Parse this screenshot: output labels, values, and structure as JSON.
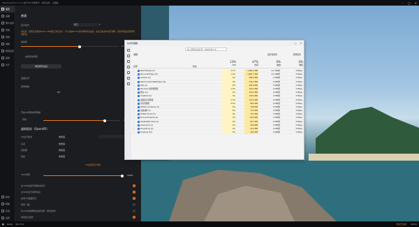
{
  "window": {
    "title": "MaxAssistant 1.2.0 [运行中] 智能助手 - 游戏设置 - 主面板"
  },
  "sidebar": {
    "items": [
      {
        "label": "首页",
        "icon": "home-icon"
      },
      {
        "label": "画面",
        "icon": "display-icon"
      },
      {
        "label": "账户设置",
        "icon": "account-icon"
      },
      {
        "label": "音效",
        "icon": "audio-icon"
      },
      {
        "label": "控制",
        "icon": "controller-icon"
      },
      {
        "label": "辅助",
        "icon": "assist-icon"
      },
      {
        "label": "按键设置",
        "icon": "keyboard-icon"
      },
      {
        "label": "其他",
        "icon": "misc-icon"
      },
      {
        "label": "关于",
        "icon": "info-icon"
      }
    ],
    "bottom": [
      {
        "label": "输出",
        "icon": "output-icon"
      },
      {
        "label": "帮助",
        "icon": "help-icon"
      },
      {
        "label": "反馈",
        "icon": "feedback-icon"
      },
      {
        "label": "设置",
        "icon": "settings-icon"
      }
    ]
  },
  "panel": {
    "title": "普通",
    "mode_label": "显示模式",
    "mode_value": "窗口",
    "warning": "请注意：如果无法看到Radio VR的窗口进行显示，可以使用Radio进行模拟测试设置，在窗口模式中进行调整，游戏可能会出现闪烁的情况。",
    "zoom_label": "缩放值",
    "zoom_value": "1.00",
    "zoom_frac": 0.6,
    "auto_label": "启用自动调整",
    "reset_btn": "重置所有设置",
    "res_label": "画面比例",
    "fps_label": "帧率限制",
    "fps_value": "80",
    "limit_label": "开启VR调整帧率限制",
    "fov_label": "视场",
    "fov_value": "144",
    "fov_frac": 0.8,
    "openxr_title": "虚拟现实（OpenXR）",
    "vr_mode_label": "VR运行模式",
    "vr_mode_value": "未激活",
    "vr_rows": [
      {
        "label": "头显",
        "value": "未激活"
      },
      {
        "label": "控制器",
        "value": "未激活"
      },
      {
        "label": "追踪",
        "value": "未激活"
      }
    ],
    "vr_link": "VR设置显示向导",
    "vr_scale_label": "VR分辨率",
    "vr_scale_value": "100%",
    "vr_scale_frac": 0.98,
    "opts": [
      {
        "label": "在VR中启用手柄震动反馈",
        "on": true
      },
      {
        "label": "在VR中显示帧率信息",
        "on": true
      },
      {
        "label": "启用VR画面稳定",
        "on": true
      },
      {
        "label": "帧率（锁）",
        "on": false
      },
      {
        "label": "在VR中启用眼动追踪功能（测试版本）",
        "on": false
      },
      {
        "label": "游戏窗口模式",
        "on": true
      }
    ]
  },
  "taskmgr": {
    "title": "任务管理器",
    "search_placeholder": "输入要搜索的名称、发布者或 PID",
    "tab": "进程",
    "run_btn": "运行新任务",
    "more_btn": "结束任务",
    "columns": [
      {
        "pct": "13%",
        "name": "CPU"
      },
      {
        "pct": "47%",
        "name": "内存"
      },
      {
        "pct": "0%",
        "name": "磁盘"
      },
      {
        "pct": "0%",
        "name": "网络"
      }
    ],
    "col_name": "名称",
    "col_status": "状态",
    "rows": [
      [
        "BearVR(Lite) (5)",
        "2.7%",
        "1,002.1 MB",
        "0.1 MB/秒",
        "0 Mbps"
      ],
      [
        "Microsoft Edge (27)",
        "1.4%",
        "1,697.7 MB",
        "0.1 MB/秒",
        "0 Mbps"
      ],
      [
        "Outlook (5)",
        "0%",
        "483.5 MB",
        "0 MB/秒",
        "0 Mbps"
      ],
      [
        "Steam Client WebHelper (8)",
        "0%",
        "416.7 MB",
        "0 MB/秒",
        "0 Mbps"
      ],
      [
        "PNA (4)",
        "0%",
        "291.8 MB",
        "0 MB/秒",
        "0 Mbps"
      ],
      [
        "Windows 资源管理器",
        "1.3%",
        "194.3 MB",
        "0 MB/秒",
        "0 Mbps"
      ],
      [
        "微信 (11)",
        "0%",
        "194.3 MB",
        "0 MB/秒",
        "0 Mbps"
      ],
      [
        "OneNote (5)",
        "0%",
        "128.4 MB",
        "0 MB/秒",
        "0 Mbps"
      ],
      [
        "桌面窗口管理器",
        "2.3%",
        "123.1 MB",
        "0 MB/秒",
        "0 Mbps"
      ],
      [
        "任务管理器",
        "0.3%",
        "88.5 MB",
        "0 MB/秒",
        "0 Mbps"
      ],
      [
        "NVIDIA Container (3)",
        "0%",
        "79.8 MB",
        "0 MB/秒",
        "0 Mbps"
      ],
      [
        "系统进程 (3)",
        "0%",
        "73.2 MB",
        "0 MB/秒",
        "0 Mbps"
      ],
      [
        "NVIDIA Share (5)",
        "0%",
        "73.2 MB",
        "0 MB/秒",
        "0 Mbps"
      ],
      [
        "Microsoft Teams (4)",
        "0%",
        "68.4 MB",
        "0 MB/秒",
        "0 Mbps"
      ],
      [
        "ClipTextWindows (4)",
        "0%",
        "60.7 MB",
        "0 MB/秒",
        "0 Mbps"
      ],
      [
        "Greenshot (2)",
        "0%",
        "49.8 MB",
        "0 MB/秒",
        "0 Mbps"
      ],
      [
        "Everything (2)",
        "0%",
        "32.0 MB",
        "0 MB/秒",
        "0 Mbps"
      ],
      [
        "Snipping Tool",
        "0%",
        "18.2 MB",
        "0 MB/秒",
        "0 Mbps"
      ]
    ]
  },
  "taskbar": {
    "left_app": "Radio",
    "left_tag": "VR 17.0",
    "right_status": "调试已启用",
    "time": "2023/"
  }
}
